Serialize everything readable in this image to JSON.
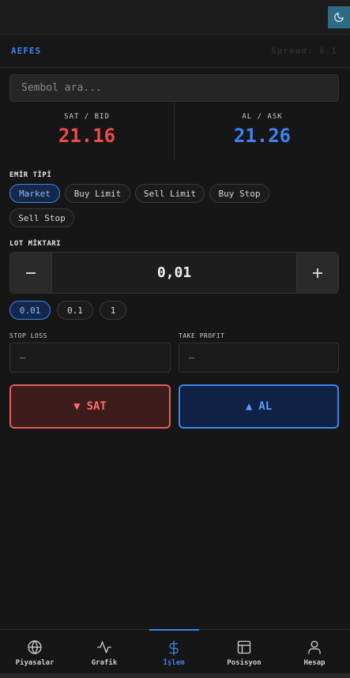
{
  "header": {
    "theme_toggle_icon": "moon-icon",
    "accent_color": "#2e6b85"
  },
  "symbol_bar": {
    "symbol": "AEFES",
    "spread": "Spread: 0.1"
  },
  "search": {
    "placeholder": "Sembol ara..."
  },
  "quotes": {
    "bid_label": "SAT / BID",
    "bid_price": "21.16",
    "ask_label": "AL / ASK",
    "ask_price": "21.26",
    "bid_color": "#ef4b4b",
    "ask_color": "#3d83f2"
  },
  "order_type": {
    "label": "EMİR TİPİ",
    "options": [
      "Market",
      "Buy Limit",
      "Sell Limit",
      "Buy Stop",
      "Sell Stop"
    ],
    "selected": "Market"
  },
  "lot": {
    "label": "LOT MİKTARI",
    "value": "0,01",
    "minus_icon": "minus-icon",
    "plus_icon": "plus-icon",
    "presets": [
      "0.01",
      "0.1",
      "1"
    ],
    "selected_preset": "0.01"
  },
  "stop_loss": {
    "label": "STOP LOSS",
    "value": "—"
  },
  "take_profit": {
    "label": "TAKE PROFIT",
    "value": "—"
  },
  "actions": {
    "sell_label": "SAT",
    "sell_icon": "▼",
    "buy_label": "AL",
    "buy_icon": "▲"
  },
  "nav": {
    "items": [
      {
        "label": "Piyasalar",
        "icon": "globe-icon"
      },
      {
        "label": "Grafik",
        "icon": "activity-icon"
      },
      {
        "label": "İşlem",
        "icon": "dollar-icon"
      },
      {
        "label": "Posisyon",
        "icon": "layout-icon"
      },
      {
        "label": "Hesap",
        "icon": "user-icon"
      }
    ],
    "active": "İşlem"
  }
}
